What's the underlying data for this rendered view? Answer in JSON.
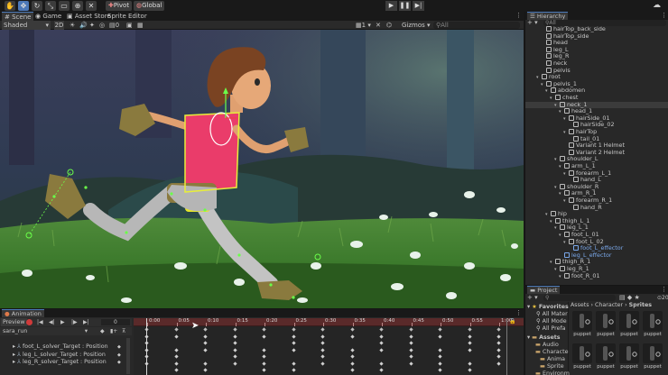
{
  "toolbar": {
    "pivot_label": "Pivot",
    "global_label": "Global"
  },
  "tabs": {
    "scene": "Scene",
    "game": "Game",
    "asset_store": "Asset Store",
    "sprite_editor": "Sprite Editor"
  },
  "scene_toolbar": {
    "shading_mode": "Shaded",
    "mode_2d": "2D",
    "layers_count": "0",
    "grid_count": "1",
    "gizmos_label": "Gizmos",
    "search_placeholder": "All"
  },
  "hierarchy": {
    "title": "Hierarchy",
    "search_placeholder": "All",
    "rows": [
      {
        "label": "hairTop_back_side",
        "depth": 3,
        "arrow": false,
        "selected": false,
        "blue": false
      },
      {
        "label": "hairTop_side",
        "depth": 3,
        "arrow": false,
        "selected": false,
        "blue": false
      },
      {
        "label": "head",
        "depth": 3,
        "arrow": false,
        "selected": false,
        "blue": false
      },
      {
        "label": "leg_L",
        "depth": 3,
        "arrow": false,
        "selected": false,
        "blue": false
      },
      {
        "label": "leg_R",
        "depth": 3,
        "arrow": false,
        "selected": false,
        "blue": false
      },
      {
        "label": "neck",
        "depth": 3,
        "arrow": false,
        "selected": false,
        "blue": false
      },
      {
        "label": "pelvis",
        "depth": 3,
        "arrow": false,
        "selected": false,
        "blue": false
      },
      {
        "label": "root",
        "depth": 2,
        "arrow": true,
        "selected": false,
        "blue": false
      },
      {
        "label": "pelvis_1",
        "depth": 3,
        "arrow": true,
        "selected": false,
        "blue": false
      },
      {
        "label": "abdomen",
        "depth": 4,
        "arrow": true,
        "selected": false,
        "blue": false
      },
      {
        "label": "chest",
        "depth": 5,
        "arrow": true,
        "selected": false,
        "blue": false
      },
      {
        "label": "neck_1",
        "depth": 6,
        "arrow": true,
        "selected": true,
        "blue": false
      },
      {
        "label": "head_1",
        "depth": 7,
        "arrow": true,
        "selected": false,
        "blue": false
      },
      {
        "label": "hairSide_01",
        "depth": 8,
        "arrow": true,
        "selected": false,
        "blue": false
      },
      {
        "label": "hairSide_02",
        "depth": 9,
        "arrow": false,
        "selected": false,
        "blue": false
      },
      {
        "label": "hairTop",
        "depth": 8,
        "arrow": true,
        "selected": false,
        "blue": false
      },
      {
        "label": "tail_01",
        "depth": 9,
        "arrow": false,
        "selected": false,
        "blue": false
      },
      {
        "label": "Variant 1 Helmet",
        "depth": 8,
        "arrow": false,
        "selected": false,
        "blue": false
      },
      {
        "label": "Variant 2 Helmet",
        "depth": 8,
        "arrow": false,
        "selected": false,
        "blue": false
      },
      {
        "label": "shoulder_L",
        "depth": 6,
        "arrow": true,
        "selected": false,
        "blue": false
      },
      {
        "label": "arm_L_1",
        "depth": 7,
        "arrow": true,
        "selected": false,
        "blue": false
      },
      {
        "label": "forearm_L_1",
        "depth": 8,
        "arrow": true,
        "selected": false,
        "blue": false
      },
      {
        "label": "hand_L",
        "depth": 9,
        "arrow": false,
        "selected": false,
        "blue": false
      },
      {
        "label": "shoulder_R",
        "depth": 6,
        "arrow": true,
        "selected": false,
        "blue": false
      },
      {
        "label": "arm_R_1",
        "depth": 7,
        "arrow": true,
        "selected": false,
        "blue": false
      },
      {
        "label": "forearm_R_1",
        "depth": 8,
        "arrow": true,
        "selected": false,
        "blue": false
      },
      {
        "label": "hand_R",
        "depth": 9,
        "arrow": false,
        "selected": false,
        "blue": false
      },
      {
        "label": "hip",
        "depth": 4,
        "arrow": true,
        "selected": false,
        "blue": false
      },
      {
        "label": "thigh_L_1",
        "depth": 5,
        "arrow": true,
        "selected": false,
        "blue": false
      },
      {
        "label": "leg_L_1",
        "depth": 6,
        "arrow": true,
        "selected": false,
        "blue": false
      },
      {
        "label": "foot_L_01",
        "depth": 7,
        "arrow": true,
        "selected": false,
        "blue": false
      },
      {
        "label": "foot_L_02",
        "depth": 8,
        "arrow": true,
        "selected": false,
        "blue": false
      },
      {
        "label": "foot_L_effector",
        "depth": 9,
        "arrow": false,
        "selected": false,
        "blue": true
      },
      {
        "label": "leg_L_effector",
        "depth": 7,
        "arrow": false,
        "selected": false,
        "blue": true
      },
      {
        "label": "thigh_R_1",
        "depth": 5,
        "arrow": true,
        "selected": false,
        "blue": false
      },
      {
        "label": "leg_R_1",
        "depth": 6,
        "arrow": true,
        "selected": false,
        "blue": false
      },
      {
        "label": "foot_R_01",
        "depth": 7,
        "arrow": true,
        "selected": false,
        "blue": false
      }
    ]
  },
  "project": {
    "title": "Project",
    "breadcrumb": [
      "Assets",
      "Character",
      "Sprites"
    ],
    "badge": "20",
    "favorites_label": "Favorites",
    "favorites": [
      "All Mater",
      "All Mode",
      "All Prefa"
    ],
    "assets_label": "Assets",
    "assets": [
      {
        "label": "Audio",
        "depth": 1
      },
      {
        "label": "Characte",
        "depth": 1
      },
      {
        "label": "Anima",
        "depth": 2
      },
      {
        "label": "Sprite",
        "depth": 2
      },
      {
        "label": "Environm",
        "depth": 1
      }
    ],
    "sprites": [
      "puppet",
      "puppet",
      "puppet",
      "puppet",
      "puppet",
      "puppet",
      "puppet",
      "puppet"
    ]
  },
  "animation": {
    "title": "Animation",
    "preview_label": "Preview",
    "frame_value": "0",
    "clip_name": "sara_run",
    "ticks": [
      "0:00",
      "0:05",
      "0:10",
      "0:15",
      "0:20",
      "0:25",
      "0:30",
      "0:35",
      "0:40",
      "0:45",
      "0:50",
      "0:55",
      "1:00"
    ],
    "properties": [
      "foot_L_solver_Target : Position",
      "leg_L_solver_Target : Position",
      "leg_R_solver_Target : Position"
    ]
  },
  "colors": {
    "accent_blue": "#4c7ab8",
    "record_red": "#d03a3a",
    "timeline_red": "#5a2a2a",
    "key_white": "#d0d0d0"
  }
}
